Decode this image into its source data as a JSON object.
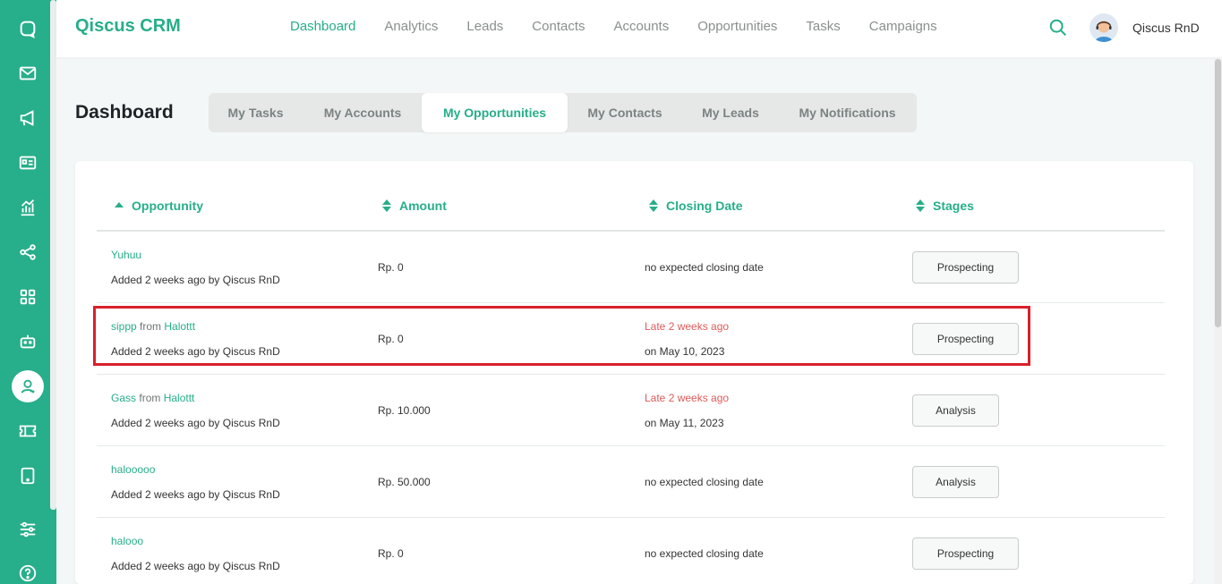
{
  "brand": "Qiscus CRM",
  "nav": [
    "Dashboard",
    "Analytics",
    "Leads",
    "Contacts",
    "Accounts",
    "Opportunities",
    "Tasks",
    "Campaigns"
  ],
  "user": {
    "name": "Qiscus RnD"
  },
  "page_title": "Dashboard",
  "tabs": [
    "My Tasks",
    "My Accounts",
    "My Opportunities",
    "My Contacts",
    "My Leads",
    "My Notifications"
  ],
  "active_tab": "My Opportunities",
  "table": {
    "headers": {
      "opportunity": "Opportunity",
      "amount": "Amount",
      "closing": "Closing Date",
      "stages": "Stages"
    },
    "rows": [
      {
        "name": "Yuhuu",
        "from": "",
        "account": "",
        "added": "Added 2 weeks ago by Qiscus RnD",
        "amount": "Rp. 0",
        "closing": "no expected closing date",
        "late": "",
        "on_date": "",
        "stage": "Prospecting"
      },
      {
        "name": "sippp",
        "from": "from",
        "account": "Halottt",
        "added": "Added 2 weeks ago by Qiscus RnD",
        "amount": "Rp. 0",
        "closing": "",
        "late": "Late 2 weeks ago",
        "on_date": "on May 10, 2023",
        "stage": "Prospecting"
      },
      {
        "name": "Gass",
        "from": "from",
        "account": "Halottt",
        "added": "Added 2 weeks ago by Qiscus RnD",
        "amount": "Rp. 10.000",
        "closing": "",
        "late": "Late 2 weeks ago",
        "on_date": "on May 11, 2023",
        "stage": "Analysis"
      },
      {
        "name": "halooooo",
        "from": "",
        "account": "",
        "added": "Added 2 weeks ago by Qiscus RnD",
        "amount": "Rp. 50.000",
        "closing": "no expected closing date",
        "late": "",
        "on_date": "",
        "stage": "Analysis"
      },
      {
        "name": "halooo",
        "from": "",
        "account": "",
        "added": "Added 2 weeks ago by Qiscus RnD",
        "amount": "Rp. 0",
        "closing": "no expected closing date",
        "late": "",
        "on_date": "",
        "stage": "Prospecting"
      }
    ]
  },
  "sidebar_icons": [
    "chat-icon",
    "mail-icon",
    "megaphone-icon",
    "id-card-icon",
    "analytics-icon",
    "share-icon",
    "apps-grid-icon",
    "robot-icon",
    "crm-user-icon",
    "ticket-icon",
    "tablet-icon",
    "settings-sliders-icon",
    "help-icon"
  ],
  "colors": {
    "accent": "#27ae8a",
    "late": "#e05a5a",
    "highlight": "#d9202a"
  }
}
